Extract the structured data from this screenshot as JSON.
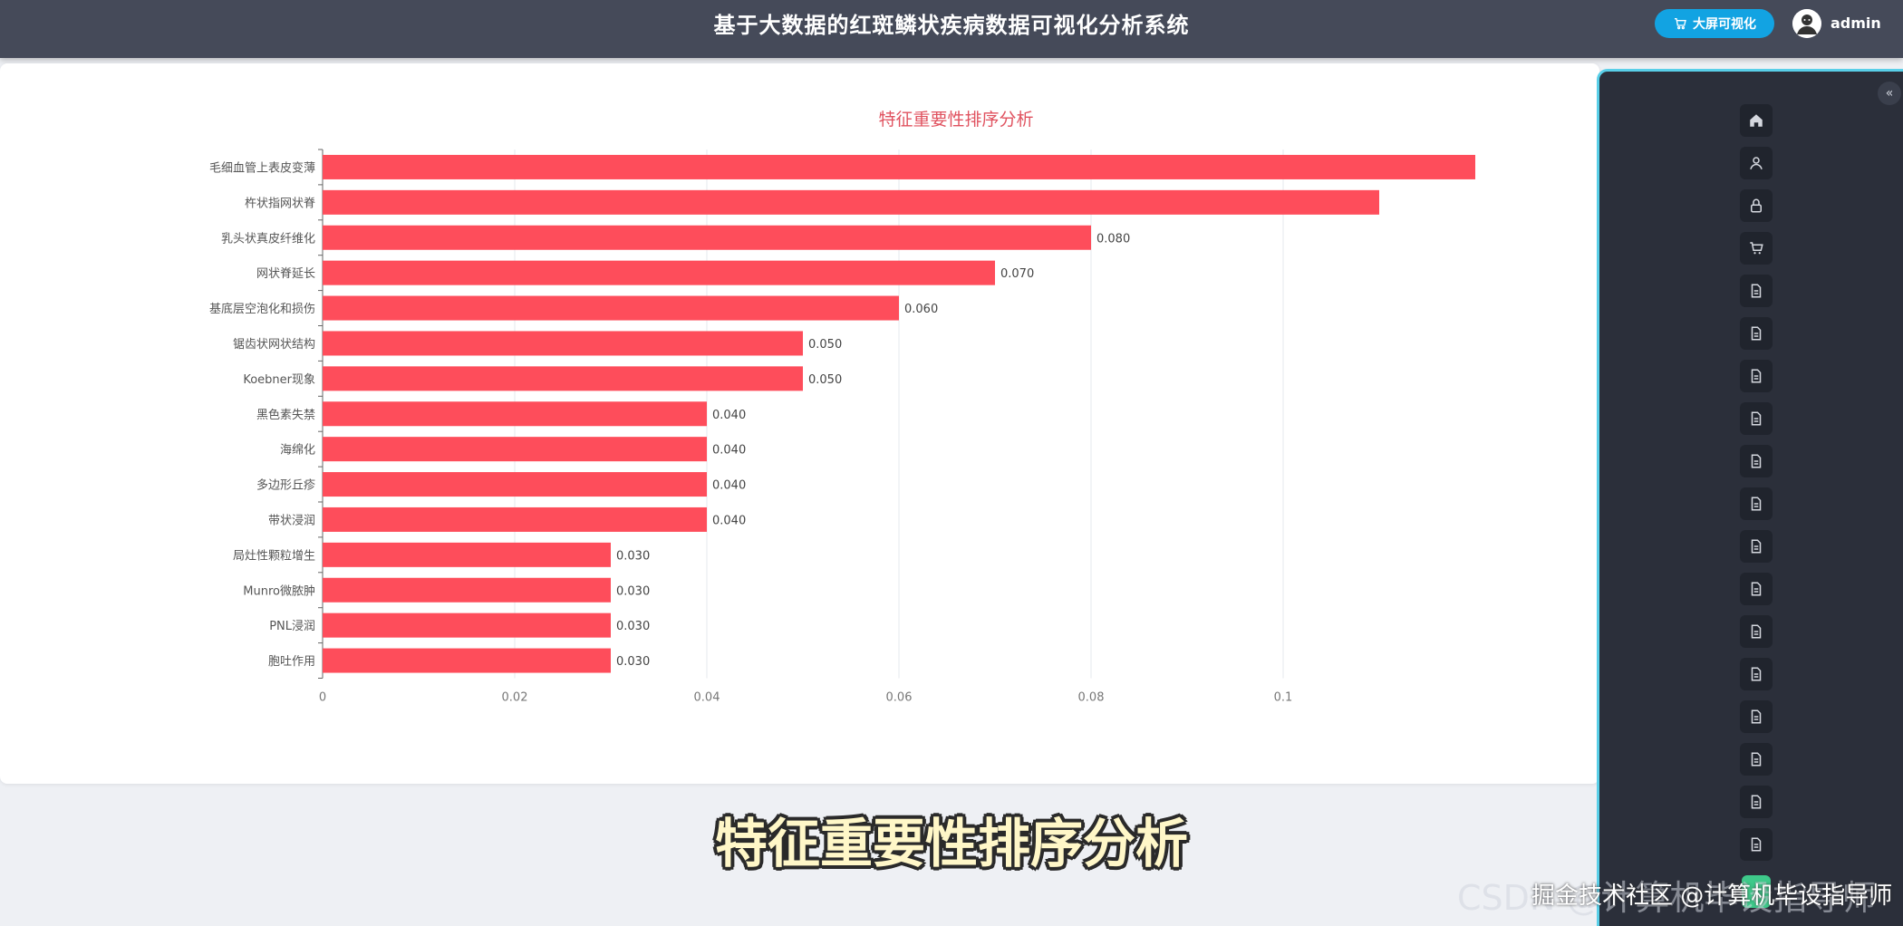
{
  "header": {
    "title": "基于大数据的红斑鳞状疾病数据可视化分析系统",
    "bigscreen_label": "大屏可视化",
    "username": "admin"
  },
  "colors": {
    "header_bg": "#454a59",
    "bar": "#fe4d5b",
    "title": "#e0525f",
    "button": "#12a3e2",
    "sidebar_bg": "#2b2f3a",
    "sidebar_border": "#59cfe8"
  },
  "chart_data": {
    "type": "bar",
    "orientation": "horizontal",
    "title": "特征重要性排序分析",
    "xlabel": "",
    "ylabel": "",
    "categories": [
      "毛细血管上表皮变薄",
      "杵状指网状脊",
      "乳头状真皮纤维化",
      "网状脊延长",
      "基底层空泡化和损伤",
      "锯齿状网状结构",
      "Koebner现象",
      "黑色素失禁",
      "海绵化",
      "多边形丘疹",
      "带状浸润",
      "局灶性颗粒增生",
      "Munro微脓肿",
      "PNL浸润",
      "胞吐作用"
    ],
    "values": [
      0.12,
      0.11,
      0.08,
      0.07,
      0.06,
      0.05,
      0.05,
      0.04,
      0.04,
      0.04,
      0.04,
      0.03,
      0.03,
      0.03,
      0.03
    ],
    "value_labels": [
      "",
      "",
      "0.080",
      "0.070",
      "0.060",
      "0.050",
      "0.050",
      "0.040",
      "0.040",
      "0.040",
      "0.040",
      "0.030",
      "0.030",
      "0.030",
      "0.030"
    ],
    "xticks": [
      "0",
      "0.02",
      "0.04",
      "0.06",
      "0.08",
      "0.1"
    ],
    "xlim": [
      0,
      0.12
    ],
    "grid": true
  },
  "sidebar": {
    "collapse_icon": "double-chevron-left-icon",
    "items": [
      {
        "icon": "home-icon"
      },
      {
        "icon": "user-icon"
      },
      {
        "icon": "lock-icon"
      },
      {
        "icon": "cart-icon"
      },
      {
        "icon": "document-icon"
      },
      {
        "icon": "document-icon"
      },
      {
        "icon": "document-icon"
      },
      {
        "icon": "document-icon"
      },
      {
        "icon": "document-icon"
      },
      {
        "icon": "document-icon"
      },
      {
        "icon": "document-icon"
      },
      {
        "icon": "document-icon"
      },
      {
        "icon": "document-icon"
      },
      {
        "icon": "document-icon"
      },
      {
        "icon": "document-icon"
      },
      {
        "icon": "document-icon"
      },
      {
        "icon": "document-icon"
      },
      {
        "icon": "document-icon"
      }
    ]
  },
  "overlay": {
    "subtitle": "特征重要性排序分析",
    "watermark_back": "CSDN @计算机毕设指导师",
    "watermark_front": "掘金技术社区 @计算机毕设指导师"
  }
}
